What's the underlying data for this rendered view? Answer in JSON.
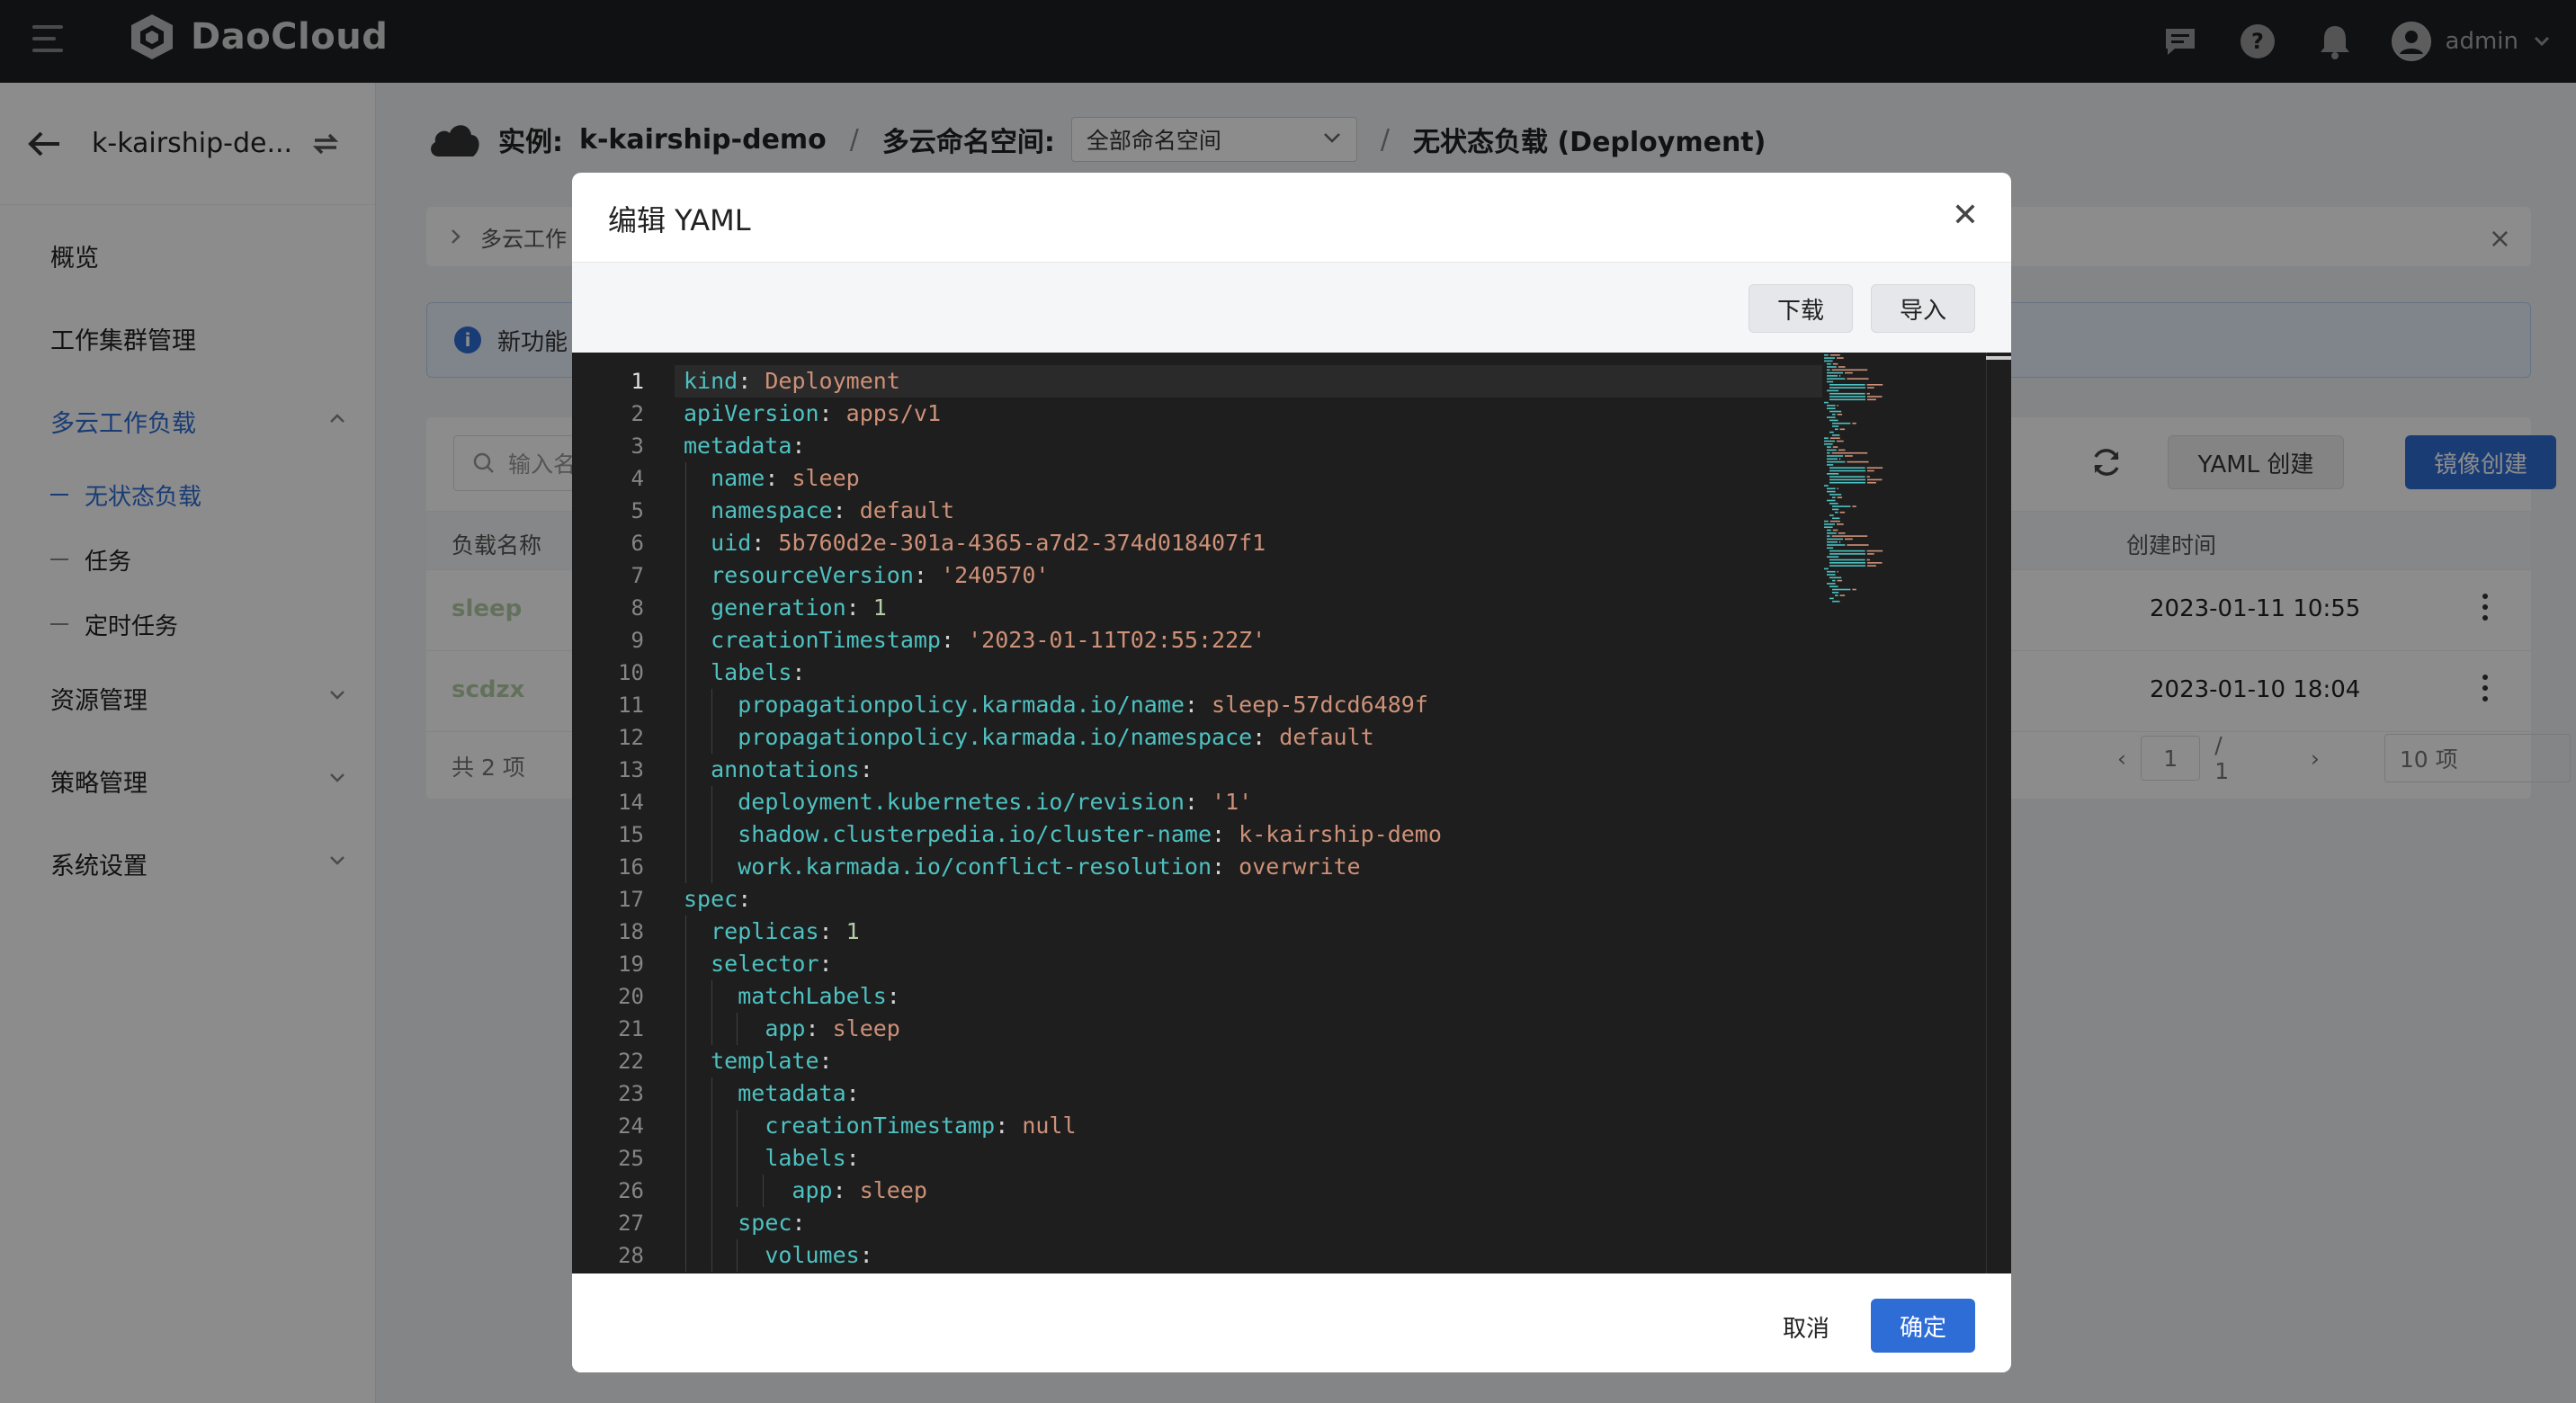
{
  "app": {
    "logo_text": "DaoCloud"
  },
  "topbar": {
    "username": "admin"
  },
  "sidebar": {
    "instance_title": "k-kairship-de...",
    "items": [
      {
        "label": "概览"
      },
      {
        "label": "工作集群管理"
      },
      {
        "label": "多云工作负载"
      },
      {
        "label": "资源管理"
      },
      {
        "label": "策略管理"
      },
      {
        "label": "系统设置"
      }
    ],
    "subitems": [
      {
        "label": "无状态负载"
      },
      {
        "label": "任务"
      },
      {
        "label": "定时任务"
      }
    ]
  },
  "breadcrumb": {
    "instance_label": "实例:",
    "instance_value": "k-kairship-demo",
    "sep1": "/",
    "namespace_label": "多云命名空间:",
    "namespace_select": "全部命名空间",
    "sep2": "/",
    "current": "无状态负载 (Deployment)"
  },
  "subnav": {
    "text": "多云工作"
  },
  "infobar": {
    "text": "新功能"
  },
  "list": {
    "search_placeholder": "输入名",
    "yaml_create": "YAML 创建",
    "image_create": "镜像创建",
    "col_name": "负载名称",
    "col_time": "创建时间",
    "rows": [
      {
        "name": "sleep",
        "time": "2023-01-11 10:55"
      },
      {
        "name": "scdzx",
        "time": "2023-01-10 18:04"
      }
    ],
    "total": "共 2 项",
    "page": "1",
    "page_total": "/ 1",
    "page_size": "10 项"
  },
  "modal": {
    "title": "编辑 YAML",
    "download": "下载",
    "import": "导入",
    "cancel": "取消",
    "confirm": "确定",
    "code_lines": [
      {
        "n": "1",
        "indent": 0,
        "key": "kind",
        "val": "Deployment",
        "vt": "v"
      },
      {
        "n": "2",
        "indent": 0,
        "key": "apiVersion",
        "val": "apps/v1",
        "vt": "v"
      },
      {
        "n": "3",
        "indent": 0,
        "key": "metadata",
        "val": "",
        "vt": "v"
      },
      {
        "n": "4",
        "indent": 1,
        "key": "name",
        "val": "sleep",
        "vt": "v"
      },
      {
        "n": "5",
        "indent": 1,
        "key": "namespace",
        "val": "default",
        "vt": "v"
      },
      {
        "n": "6",
        "indent": 1,
        "key": "uid",
        "val": "5b760d2e-301a-4365-a7d2-374d018407f1",
        "vt": "v"
      },
      {
        "n": "7",
        "indent": 1,
        "key": "resourceVersion",
        "val": "'240570'",
        "vt": "v"
      },
      {
        "n": "8",
        "indent": 1,
        "key": "generation",
        "val": "1",
        "vt": "n"
      },
      {
        "n": "9",
        "indent": 1,
        "key": "creationTimestamp",
        "val": "'2023-01-11T02:55:22Z'",
        "vt": "v"
      },
      {
        "n": "10",
        "indent": 1,
        "key": "labels",
        "val": "",
        "vt": "v"
      },
      {
        "n": "11",
        "indent": 2,
        "key": "propagationpolicy.karmada.io/name",
        "val": "sleep-57dcd6489f",
        "vt": "v"
      },
      {
        "n": "12",
        "indent": 2,
        "key": "propagationpolicy.karmada.io/namespace",
        "val": "default",
        "vt": "v"
      },
      {
        "n": "13",
        "indent": 1,
        "key": "annotations",
        "val": "",
        "vt": "v"
      },
      {
        "n": "14",
        "indent": 2,
        "key": "deployment.kubernetes.io/revision",
        "val": "'1'",
        "vt": "v"
      },
      {
        "n": "15",
        "indent": 2,
        "key": "shadow.clusterpedia.io/cluster-name",
        "val": "k-kairship-demo",
        "vt": "v"
      },
      {
        "n": "16",
        "indent": 2,
        "key": "work.karmada.io/conflict-resolution",
        "val": "overwrite",
        "vt": "v"
      },
      {
        "n": "17",
        "indent": 0,
        "key": "spec",
        "val": "",
        "vt": "v"
      },
      {
        "n": "18",
        "indent": 1,
        "key": "replicas",
        "val": "1",
        "vt": "n"
      },
      {
        "n": "19",
        "indent": 1,
        "key": "selector",
        "val": "",
        "vt": "v"
      },
      {
        "n": "20",
        "indent": 2,
        "key": "matchLabels",
        "val": "",
        "vt": "v"
      },
      {
        "n": "21",
        "indent": 3,
        "key": "app",
        "val": "sleep",
        "vt": "v"
      },
      {
        "n": "22",
        "indent": 1,
        "key": "template",
        "val": "",
        "vt": "v"
      },
      {
        "n": "23",
        "indent": 2,
        "key": "metadata",
        "val": "",
        "vt": "v"
      },
      {
        "n": "24",
        "indent": 3,
        "key": "creationTimestamp",
        "val": "null",
        "vt": "v"
      },
      {
        "n": "25",
        "indent": 3,
        "key": "labels",
        "val": "",
        "vt": "v"
      },
      {
        "n": "26",
        "indent": 4,
        "key": "app",
        "val": "sleep",
        "vt": "v"
      },
      {
        "n": "27",
        "indent": 2,
        "key": "spec",
        "val": "",
        "vt": "v"
      },
      {
        "n": "28",
        "indent": 3,
        "key": "volumes",
        "val": "",
        "vt": "v"
      }
    ]
  }
}
